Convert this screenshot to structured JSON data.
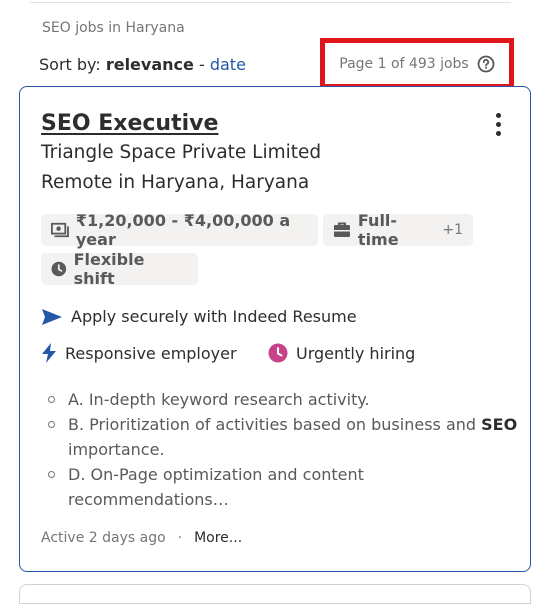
{
  "header": {
    "breadcrumb": "SEO jobs in Haryana",
    "sort_label": "Sort by:",
    "sort_active": "relevance",
    "sort_separator": "-",
    "sort_alt": "date",
    "page_info": "Page 1 of 493 jobs"
  },
  "job": {
    "title": "SEO Executive",
    "company": "Triangle Space Private Limited",
    "location": "Remote in Haryana, Haryana",
    "salary": "₹1,20,000 - ₹4,00,000 a year",
    "job_type": "Full-time",
    "job_type_extra": "+1",
    "shift": "Flexible shift",
    "apply_text": "Apply securely with Indeed Resume",
    "responsive_text": "Responsive employer",
    "urgent_text": "Urgently hiring",
    "snippets": {
      "s1": "A. In-depth keyword research activity.",
      "s2_pre": "B. Prioritization of activities based on business and ",
      "s2_bold": "SEO",
      "s2_post": " importance.",
      "s3": "D. On-Page optimization and content recommendations…"
    },
    "posted": "Active 2 days ago",
    "footer_sep": "·",
    "more": "More..."
  },
  "colors": {
    "accent": "#2557a7",
    "highlight_box": "#e0161d",
    "urgent_icon": "#c74289"
  }
}
